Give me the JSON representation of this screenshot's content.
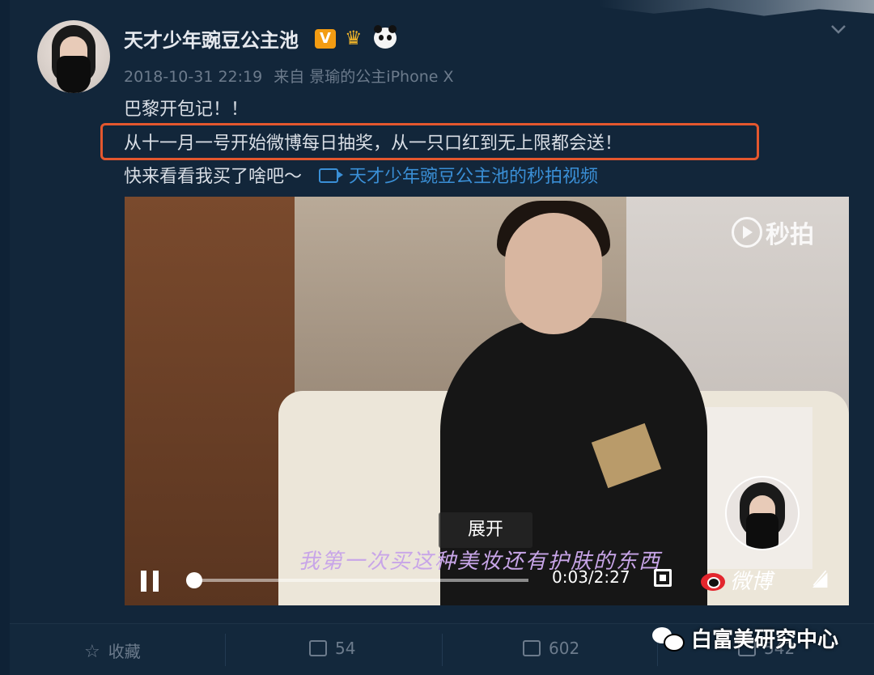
{
  "post": {
    "author": "天才少年豌豆公主池",
    "verified_badge": "V",
    "meta_time": "2018-10-31 22:19",
    "meta_source": "来自 景瑜的公主iPhone X",
    "line1": "巴黎开包记！！",
    "line2": "从十一月一号开始微博每日抽奖，从一只口红到无上限都会送！",
    "line3": "快来看看我买了啥吧～",
    "video_link": "天才少年豌豆公主池的秒拍视频",
    "highlight_color": "#e4572e"
  },
  "video": {
    "watermark": "秒拍",
    "subtitle": "我第一次买这种美妆还有护肤的东西",
    "expand_label": "展开",
    "time": "0:03/2:27",
    "progress_fraction": 0.021,
    "weibo_logo": "微博"
  },
  "actions": {
    "favorite": "收藏",
    "repost": "54",
    "comment": "602",
    "like": "542"
  },
  "overlay_watermark": "白富美研究中心",
  "icons": [
    "chevron-down-icon",
    "crown-icon",
    "panda-icon",
    "video-icon",
    "pause-icon",
    "fullscreen-icon",
    "mute-icon",
    "star-icon",
    "repost-icon",
    "comment-icon",
    "like-icon",
    "wechat-icon"
  ]
}
